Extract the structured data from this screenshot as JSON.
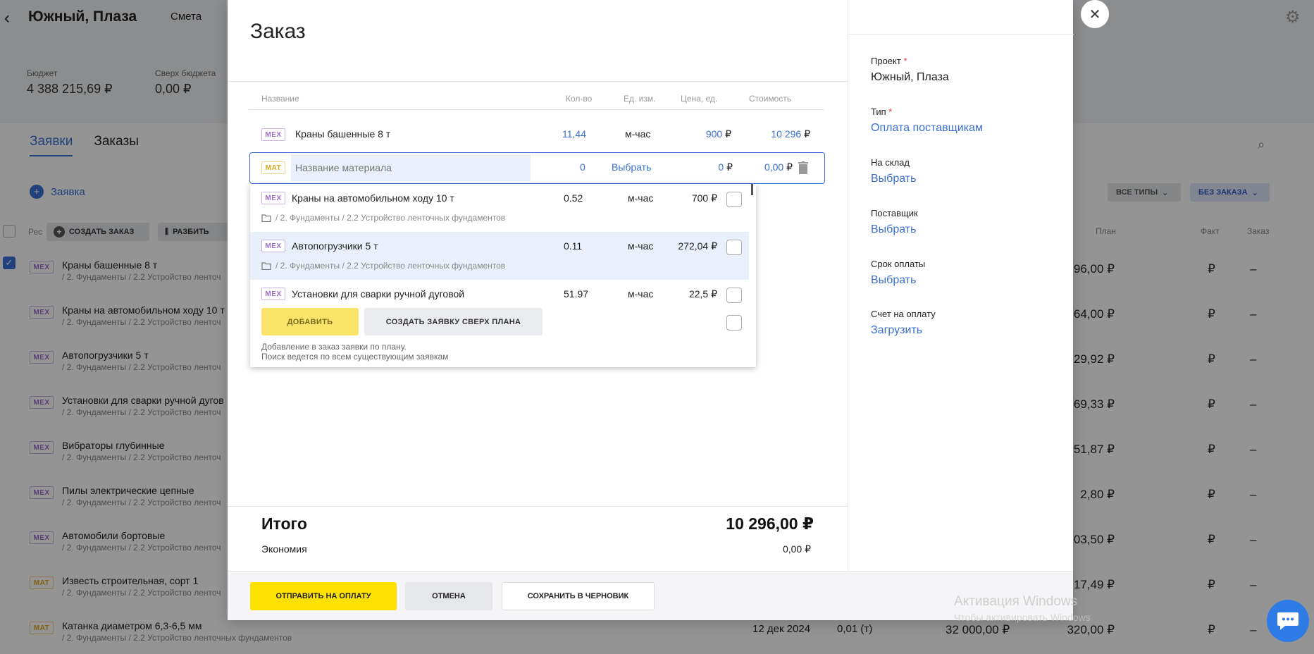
{
  "background": {
    "title": "Южный, Плаза",
    "tab_smeta": "Смета",
    "budget_label": "Бюджет",
    "budget_value": "4 388 215,69 ₽",
    "over_label": "Сверх бюджета",
    "over_value": "0,00 ₽",
    "tabs": [
      "Заявки",
      "Заказы"
    ],
    "add_label": "Заявка",
    "res_label": "Рес",
    "create_order_label": "СОЗДАТЬ ЗАКАЗ",
    "split_label": "РАЗБИТЬ",
    "filter_all_types": "ВСЕ ТИПЫ",
    "filter_no_order": "БЕЗ ЗАКАЗА",
    "col_plan": "План",
    "col_fact": "Факт",
    "col_order": "Заказ",
    "rows": [
      {
        "type": "MEX",
        "name": "Краны башенные 8 т",
        "path": "/ 2. Фундаменты / 2.2 Устройство ленточ",
        "plan": "296,00 ₽",
        "fact": "₽",
        "order": "–"
      },
      {
        "type": "MEX",
        "name": "Краны на автомобильном ходу 10 т",
        "path": "/ 2. Фундаменты / 2.2 Устройство ленточ",
        "plan": "64,00 ₽",
        "fact": "₽",
        "order": "–"
      },
      {
        "type": "MEX",
        "name": "Автопогрузчики 5 т",
        "path": "/ 2. Фундаменты / 2.2 Устройство ленточ",
        "plan": "29,92 ₽",
        "fact": "₽",
        "order": "–"
      },
      {
        "type": "MEX",
        "name": "Установки для сварки ручной дугов",
        "path": "/ 2. Фундаменты / 2.2 Устройство ленточ",
        "plan": "69,33 ₽",
        "fact": "₽",
        "order": "–"
      },
      {
        "type": "MEX",
        "name": "Вибраторы глубинные",
        "path": "/ 2. Фундаменты / 2.2 Устройство ленточ",
        "plan": "51,87 ₽",
        "fact": "₽",
        "order": "–"
      },
      {
        "type": "MEX",
        "name": "Пилы электрические цепные",
        "path": "/ 2. Фундаменты / 2.2 Устройство ленточ",
        "plan": "2,80 ₽",
        "fact": "₽",
        "order": "–"
      },
      {
        "type": "MEX",
        "name": "Автомобили бортовые",
        "path": "/ 2. Фундаменты / 2.2 Устройство ленточ",
        "plan": "03,50 ₽",
        "fact": "₽",
        "order": "–"
      },
      {
        "type": "MAT",
        "name": "Известь строительная, сорт 1",
        "path": "/ 2. Фундаменты / 2.2 Устройство ленточ",
        "plan": "17,49 ₽",
        "fact": "₽",
        "order": "–"
      },
      {
        "type": "MAT",
        "name": "Катанка диаметром 6,3-6,5 мм",
        "path": "/ 2. Фундаменты / 2.2 Устройство ленточных фундаментов",
        "plan": "320,00 ₽",
        "fact": "₽",
        "order": "–",
        "date": "12 дек 2024",
        "qty": "0,01 (т)",
        "sum": "32 000,00 ₽"
      }
    ]
  },
  "modal": {
    "title": "Заказ",
    "columns": {
      "name": "Название",
      "qty": "Кол-во",
      "unit": "Ед. изм.",
      "price": "Цена, ед.",
      "cost": "Стоимость"
    },
    "items": [
      {
        "type": "MEX",
        "name": "Краны башенные 8 т",
        "qty": "11,44",
        "unit": "м-час",
        "price": "900",
        "cost": "10 296",
        "currency": "₽"
      }
    ],
    "edit_row": {
      "type": "MAT",
      "placeholder": "Название материала",
      "qty": "0",
      "unit": "Выбрать",
      "price": "0",
      "cost": "0,00",
      "currency": "₽"
    },
    "dropdown": {
      "items": [
        {
          "type": "MEX",
          "name": "Краны на автомобильном ходу 10 т",
          "qty": "0.52",
          "unit": "м-час",
          "price": "700 ₽",
          "path": "/ 2. Фундаменты / 2.2 Устройство ленточных фундаментов"
        },
        {
          "type": "MEX",
          "name": "Автопогрузчики 5 т",
          "qty": "0.11",
          "unit": "м-час",
          "price": "272,04 ₽",
          "path": "/ 2. Фундаменты / 2.2 Устройство ленточных фундаментов"
        },
        {
          "type": "MEX",
          "name": "Установки для сварки ручной дуговой",
          "qty": "51.97",
          "unit": "м-час",
          "price": "22,5 ₽"
        }
      ],
      "add_button": "ДОБАВИТЬ",
      "create_button": "СОЗДАТЬ ЗАЯВКУ СВЕРХ ПЛАНА",
      "hint_line1": "Добавление в заказ заявки по плану.",
      "hint_line2": "Поиск ведется по всем существующим заявкам"
    },
    "total_label": "Итого",
    "total_value": "10 296,00 ₽",
    "economy_label": "Экономия",
    "economy_value": "0,00 ₽",
    "btn_send": "ОТПРАВИТЬ НА ОПЛАТУ",
    "btn_cancel": "ОТМЕНА",
    "btn_draft": "СОХРАНИТЬ В ЧЕРНОВИК",
    "side": {
      "project_label": "Проект",
      "project_value": "Южный, Плаза",
      "type_label": "Тип",
      "type_value": "Оплата поставщикам",
      "warehouse_label": "На склад",
      "warehouse_value": "Выбрать",
      "supplier_label": "Поставщик",
      "supplier_value": "Выбрать",
      "due_label": "Срок оплаты",
      "due_value": "Выбрать",
      "invoice_label": "Счет на оплату",
      "invoice_value": "Загрузить"
    }
  },
  "watermark": {
    "line1": "Активация Windows",
    "line2": "Чтобы активировать Windows"
  },
  "colors": {
    "accent": "#3b6fd4",
    "primary_button": "#fde100",
    "required": "#e53935"
  }
}
